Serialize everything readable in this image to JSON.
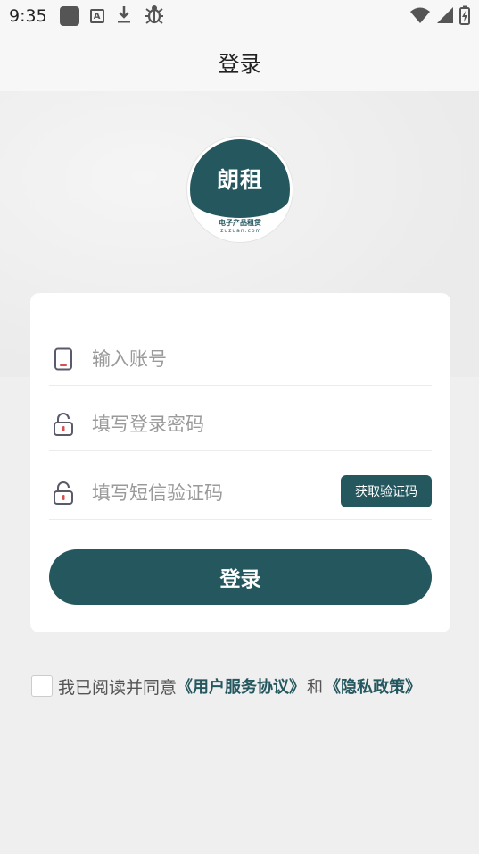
{
  "status_bar": {
    "time": "9:35",
    "icons": [
      "square-app-icon",
      "a-badge-icon",
      "download-icon",
      "bug-icon",
      "wifi-icon",
      "signal-icon",
      "battery-charging-icon"
    ]
  },
  "header": {
    "title": "登录"
  },
  "logo": {
    "name": "朗租",
    "subtitle": "电子产品租赁",
    "site": "lzuzuan.com"
  },
  "form": {
    "account_placeholder": "输入账号",
    "password_placeholder": "填写登录密码",
    "sms_placeholder": "填写短信验证码",
    "get_code_label": "获取验证码",
    "login_label": "登录"
  },
  "agreement": {
    "prefix": "我已阅读并同意",
    "user_agreement": "《用户服务协议》",
    "and": "和",
    "privacy_policy": "《隐私政策》"
  },
  "colors": {
    "primary": "#25575e",
    "background": "#efefef",
    "card": "#ffffff"
  }
}
